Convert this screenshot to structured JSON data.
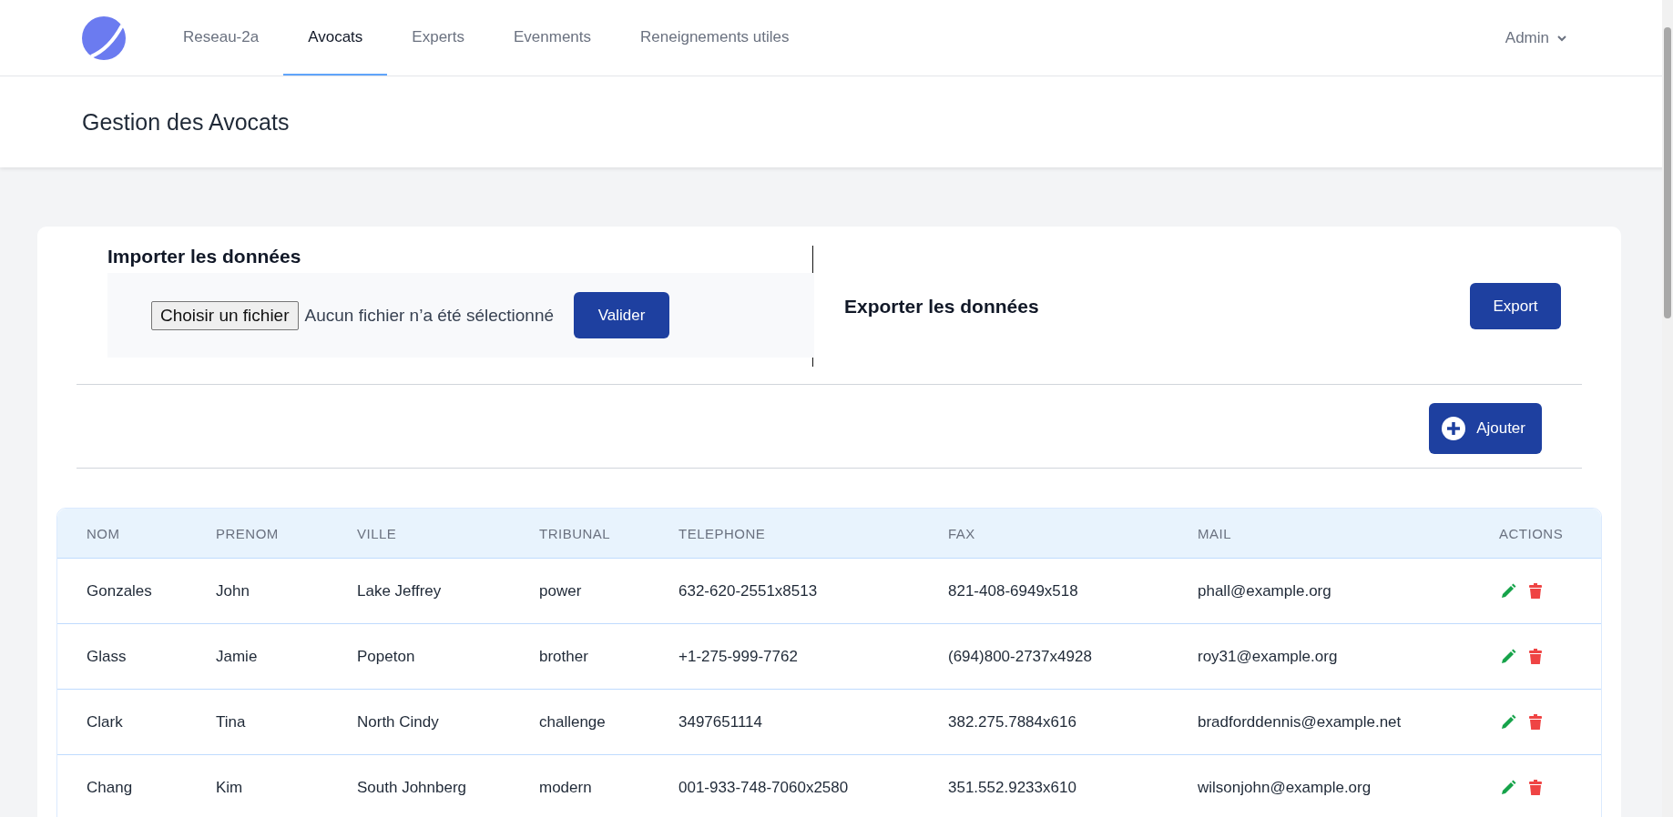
{
  "nav": {
    "items": [
      {
        "label": "Reseau-2a",
        "selected": false
      },
      {
        "label": "Avocats",
        "selected": true
      },
      {
        "label": "Experts",
        "selected": false
      },
      {
        "label": "Evenments",
        "selected": false
      },
      {
        "label": "Reneignements utiles",
        "selected": false
      }
    ],
    "user": "Admin"
  },
  "page_title": "Gestion des Avocats",
  "import": {
    "title": "Importer les données",
    "file_button": "Choisir un fichier",
    "file_status": "Aucun fichier n’a été sélectionné",
    "submit": "Valider"
  },
  "export": {
    "title": "Exporter les données",
    "button": "Export"
  },
  "add_button": "Ajouter",
  "table": {
    "columns": [
      "NOM",
      "PRENOM",
      "VILLE",
      "TRIBUNAL",
      "TELEPHONE",
      "FAX",
      "MAIL",
      "ACTIONS"
    ],
    "rows": [
      [
        "Gonzales",
        "John",
        "Lake Jeffrey",
        "power",
        "632-620-2551x8513",
        "821-408-6949x518",
        "phall@example.org"
      ],
      [
        "Glass",
        "Jamie",
        "Popeton",
        "brother",
        "+1-275-999-7762",
        "(694)800-2737x4928",
        "roy31@example.org"
      ],
      [
        "Clark",
        "Tina",
        "North Cindy",
        "challenge",
        "3497651114",
        "382.275.7884x616",
        "bradforddennis@example.net"
      ],
      [
        "Chang",
        "Kim",
        "South Johnberg",
        "modern",
        "001-933-748-7060x2580",
        "351.552.9233x610",
        "wilsonjohn@example.org"
      ]
    ]
  }
}
